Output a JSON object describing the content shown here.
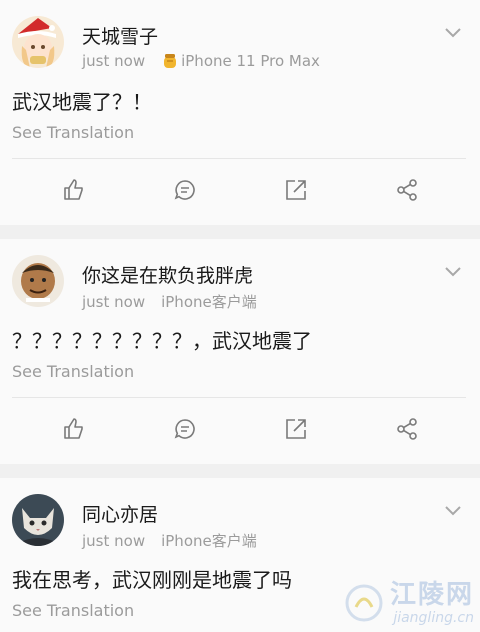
{
  "posts": [
    {
      "username": "天城雪子",
      "time": "just now",
      "device": "iPhone 11 Pro Max",
      "device_icon": "honey-jar-icon",
      "content": "武汉地震了？！",
      "translate": "See Translation"
    },
    {
      "username": "你这是在欺负我胖虎",
      "time": "just now",
      "device": "iPhone客户端",
      "content": "？？？？？？？？？，武汉地震了",
      "translate": "See Translation"
    },
    {
      "username": "同心亦居",
      "time": "just now",
      "device": "iPhone客户端",
      "content": "我在思考，武汉刚刚是地震了吗",
      "translate": "See Translation"
    }
  ],
  "actions": [
    "like-icon",
    "comment-icon",
    "share-icon",
    "forward-icon"
  ],
  "watermark": {
    "title": "江陵网",
    "url": "jiangling.cn"
  },
  "colors": {
    "background": "#f0f0f0",
    "card": "#fafafa",
    "text": "#1a1a1a",
    "muted": "#9b9b9b"
  }
}
